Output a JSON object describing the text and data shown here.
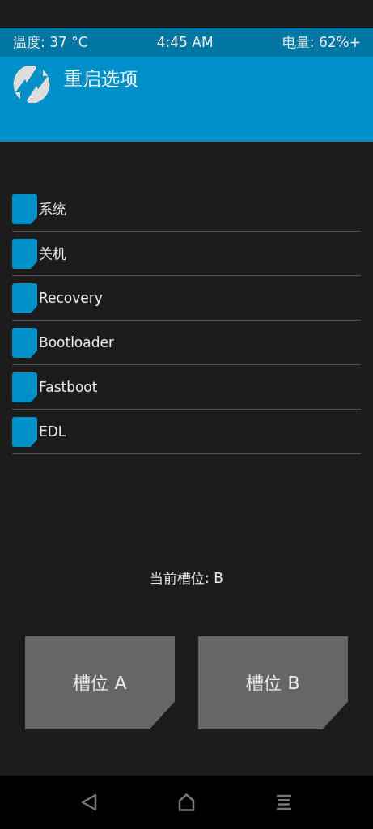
{
  "status_bar": {
    "temperature": "温度: 37 °C",
    "time": "4:45 AM",
    "battery": "电量: 62%+"
  },
  "header": {
    "title": "重启选项"
  },
  "options": [
    {
      "label": "系统",
      "selected": false
    },
    {
      "label": "关机",
      "selected": false
    },
    {
      "label": "Recovery",
      "selected": false
    },
    {
      "label": "Bootloader",
      "selected": false
    },
    {
      "label": "Fastboot",
      "selected": false
    },
    {
      "label": "EDL",
      "selected": false
    }
  ],
  "current_slot": "当前槽位: B",
  "slot_buttons": [
    "槽位 A",
    "槽位 B"
  ]
}
